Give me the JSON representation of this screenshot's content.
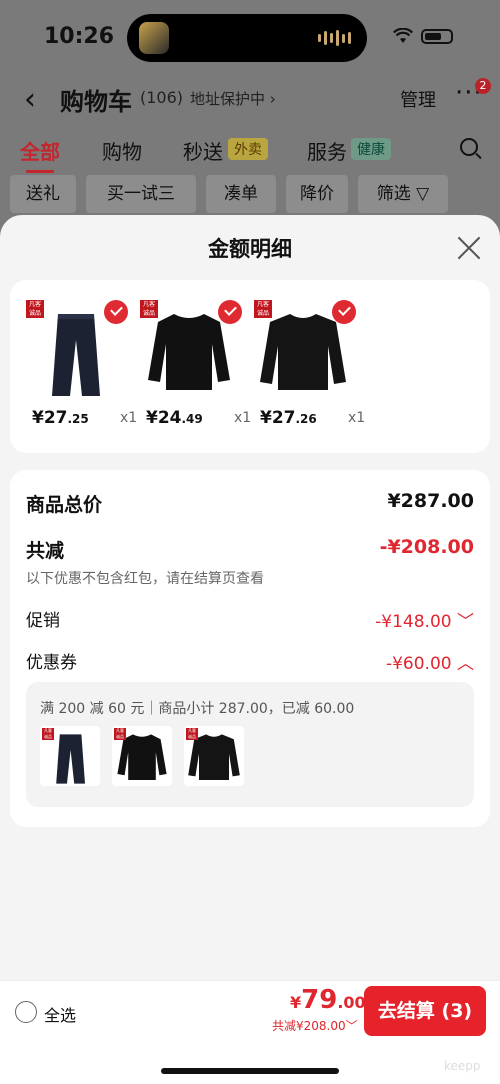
{
  "status_bar": {
    "time": "10:26"
  },
  "nav": {
    "title": "购物车",
    "count": "(106)",
    "address": "地址保护中 ›",
    "manage": "管理",
    "more": "···",
    "badge": "2"
  },
  "tabs": [
    {
      "label": "全部",
      "active": true
    },
    {
      "label": "购物"
    },
    {
      "label": "秒送",
      "badge": "外卖"
    },
    {
      "label": "服务",
      "badge": "健康"
    }
  ],
  "chips": [
    "送礼",
    "买一试三",
    "凑单",
    "降价",
    "筛选 ▽"
  ],
  "sheet": {
    "title": "金额明细",
    "products": [
      {
        "tag": "凡客诚品",
        "price_int": "¥27",
        "price_dec": ".25",
        "qty": "x1",
        "color": "#1d2233",
        "kind": "pants"
      },
      {
        "tag": "凡客诚品",
        "price_int": "¥24",
        "price_dec": ".49",
        "qty": "x1",
        "color": "#111111",
        "kind": "sweater"
      },
      {
        "tag": "凡客诚品",
        "price_int": "¥27",
        "price_dec": ".26",
        "qty": "x1",
        "color": "#141414",
        "kind": "sweater"
      }
    ],
    "summary": {
      "total_label": "商品总价",
      "total_value": "¥287.00",
      "discount_label": "共减",
      "discount_value": "-¥208.00",
      "discount_hint": "以下优惠不包含红包，请在结算页查看",
      "promo_label": "促销",
      "promo_value": "-¥148.00 ﹀",
      "coupon_label": "优惠券",
      "coupon_value": "-¥60.00 ︿",
      "coupon_detail": "满 200 减 60 元｜商品小计 287.00，已减 60.00"
    }
  },
  "bottom": {
    "select_all": "全选",
    "total_currency": "¥",
    "total_int": "79",
    "total_dec": ".00",
    "saved": "共减¥208.00﹀",
    "checkout": "去结算 (3)",
    "watermark": "keepp"
  },
  "colors": {
    "accent": "#e0262e",
    "brand_red": "#c0171f"
  }
}
